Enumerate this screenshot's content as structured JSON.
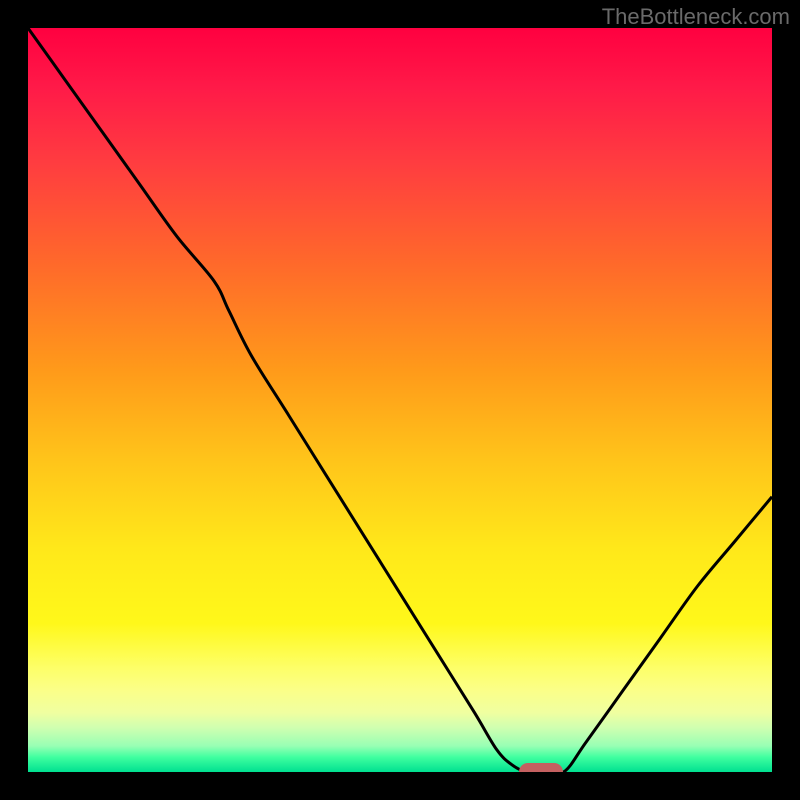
{
  "watermark": "TheBottleneck.com",
  "colors": {
    "page_bg": "#000000",
    "watermark_text": "#6a6a6a",
    "curve_stroke": "#000000",
    "marker_fill": "#c46060"
  },
  "chart_data": {
    "type": "line",
    "title": "",
    "xlabel": "",
    "ylabel": "",
    "xlim": [
      0,
      100
    ],
    "ylim": [
      0,
      100
    ],
    "grid": false,
    "legend": false,
    "x": [
      0,
      5,
      10,
      15,
      20,
      25,
      27,
      30,
      35,
      40,
      45,
      50,
      55,
      60,
      63,
      65,
      67,
      69,
      72,
      75,
      80,
      85,
      90,
      95,
      100
    ],
    "y": [
      100,
      93,
      86,
      79,
      72,
      66,
      62,
      56,
      48,
      40,
      32,
      24,
      16,
      8,
      3,
      1,
      0,
      0,
      0,
      4,
      11,
      18,
      25,
      31,
      37
    ],
    "marker": {
      "x": 69,
      "y": 0
    }
  }
}
